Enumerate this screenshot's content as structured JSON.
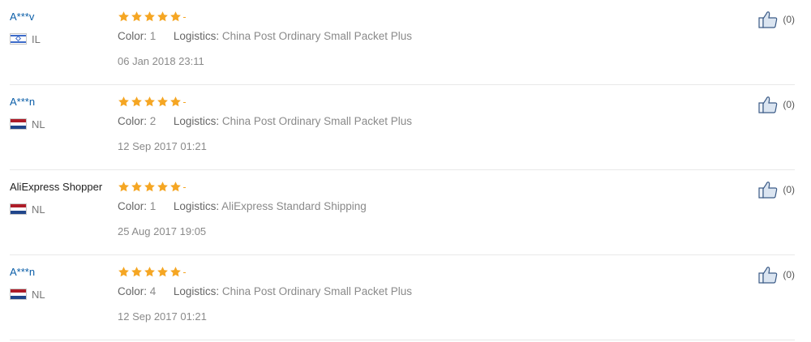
{
  "reviews": [
    {
      "user": "A***v",
      "user_style": "link",
      "country_code": "IL",
      "flag": "il-flag-icon",
      "rating_stars": 5,
      "color_label": "Color:",
      "color_value": "1",
      "logistics_label": "Logistics:",
      "logistics_value": "China Post Ordinary Small Packet Plus",
      "date": "06 Jan 2018 23:11",
      "helpful_count": "(0)"
    },
    {
      "user": "A***n",
      "user_style": "link",
      "country_code": "NL",
      "flag": "nl-flag-icon",
      "rating_stars": 5,
      "color_label": "Color:",
      "color_value": "2",
      "logistics_label": "Logistics:",
      "logistics_value": "China Post Ordinary Small Packet Plus",
      "date": "12 Sep 2017 01:21",
      "helpful_count": "(0)"
    },
    {
      "user": "AliExpress Shopper",
      "user_style": "plain",
      "country_code": "NL",
      "flag": "nl-flag-icon",
      "rating_stars": 5,
      "color_label": "Color:",
      "color_value": "1",
      "logistics_label": "Logistics:",
      "logistics_value": "AliExpress Standard Shipping",
      "date": "25 Aug 2017 19:05",
      "helpful_count": "(0)"
    },
    {
      "user": "A***n",
      "user_style": "link",
      "country_code": "NL",
      "flag": "nl-flag-icon",
      "rating_stars": 5,
      "color_label": "Color:",
      "color_value": "4",
      "logistics_label": "Logistics:",
      "logistics_value": "China Post Ordinary Small Packet Plus",
      "date": "12 Sep 2017 01:21",
      "helpful_count": "(0)"
    }
  ],
  "colors": {
    "star": "#f5a623",
    "user_link": "#0b5ea8",
    "divider": "#e8e8e8",
    "thumb_outline": "#3a5a86"
  },
  "icons": {
    "helpful": "thumbs-up-icon",
    "rating": "star-icon"
  }
}
